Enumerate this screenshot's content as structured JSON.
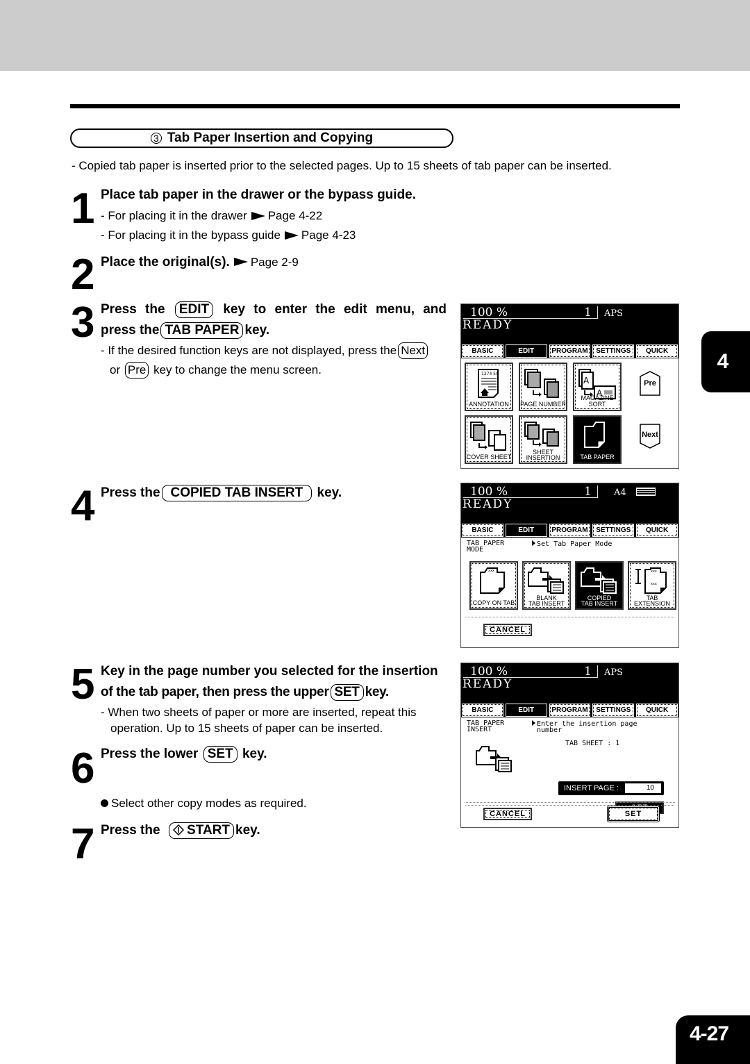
{
  "section": {
    "number_glyph": "3",
    "title": "Tab Paper Insertion and Copying",
    "intro": "-  Copied tab paper is inserted prior to the selected pages.  Up to 15 sheets of tab paper can be inserted."
  },
  "steps": [
    {
      "number": "1",
      "heading": "Place tab paper in the drawer or the bypass guide.",
      "subs": [
        {
          "text": "-  For placing it in the drawer",
          "ref": "Page 4-22"
        },
        {
          "text": "-  For placing it in the bypass guide",
          "ref": "Page 4-23"
        }
      ]
    },
    {
      "number": "2",
      "heading": "Place the original(s).",
      "ref": "Page 2-9"
    },
    {
      "number": "3",
      "heading_pre": "Press the",
      "key1": "EDIT",
      "heading_mid": "key to enter the edit menu, and",
      "heading_line2_pre": "press the",
      "key2": "TAB PAPER",
      "heading_post": "key.",
      "note_pre": "-  If the desired function keys are not displayed, press the",
      "note_key1": "Next",
      "note_line2_pre": "or",
      "note_key2": "Pre",
      "note_post": "key to change the menu screen."
    },
    {
      "number": "4",
      "heading_pre": "Press the",
      "key": "COPIED TAB INSERT",
      "heading_post": "key."
    },
    {
      "number": "5",
      "heading_line1": "Key in the page number you selected for the insertion",
      "heading_line2_pre": "of the tab paper, then press the upper",
      "key": "SET",
      "heading_post": "key.",
      "note_line1": "-  When two sheets of paper or more are inserted, repeat this",
      "note_line2": "operation. Up to 15 sheets of paper can be inserted."
    },
    {
      "number": "6",
      "heading_pre": "Press the lower",
      "key": "SET",
      "heading_post": "key.",
      "bullet": "Select other copy modes as required."
    },
    {
      "number": "7",
      "heading_pre": "Press the",
      "key_icon": "start-diamond-icon",
      "key": "START",
      "heading_post": "key."
    }
  ],
  "panels": {
    "common": {
      "zoom": "100  %",
      "count": "1",
      "status": "READY",
      "tabs": [
        "BASIC",
        "EDIT",
        "PROGRAM",
        "SETTINGS",
        "QUICK"
      ],
      "active_tab": "EDIT"
    },
    "panel1": {
      "paper": "APS",
      "buttons": [
        "ANNOTATION",
        "PAGE NUMBER",
        "MAGAZINE SORT",
        "COVER SHEET",
        "SHEET INSERTION",
        "TAB PAPER"
      ],
      "annotation_stamp": "1274 50",
      "active_button": "TAB PAPER",
      "pre": "Pre",
      "next": "Next"
    },
    "panel2": {
      "paper": "A4",
      "mode_label_1": "TAB PAPER",
      "mode_label_2": "MODE",
      "message": "Set Tab Paper Mode",
      "buttons": [
        "COPY ON TAB",
        "BLANK TAB INSERT",
        "COPIED TAB INSERT",
        "TAB EXTENSION"
      ],
      "button_lines": [
        [
          "COPY ON TAB"
        ],
        [
          "BLANK",
          "TAB INSERT"
        ],
        [
          "COPIED",
          "TAB INSERT"
        ],
        [
          "TAB",
          "EXTENSION"
        ]
      ],
      "active_button": "COPIED TAB INSERT",
      "tab_mark": "xxx",
      "cancel": "CANCEL"
    },
    "panel3": {
      "paper": "APS",
      "mode_label_1": "TAB PAPER",
      "mode_label_2": "INSERT",
      "message_1": "Enter the insertion page",
      "message_2": "number",
      "tab_sheet_label": "TAB SHEET  :",
      "tab_sheet_value": "1",
      "insert_page_label": "INSERT PAGE  :",
      "insert_page_value": "10",
      "upper_set": "SET",
      "cancel": "CANCEL",
      "lower_set": "SET"
    }
  },
  "chapter_tab": "4",
  "page_number": "4-27"
}
